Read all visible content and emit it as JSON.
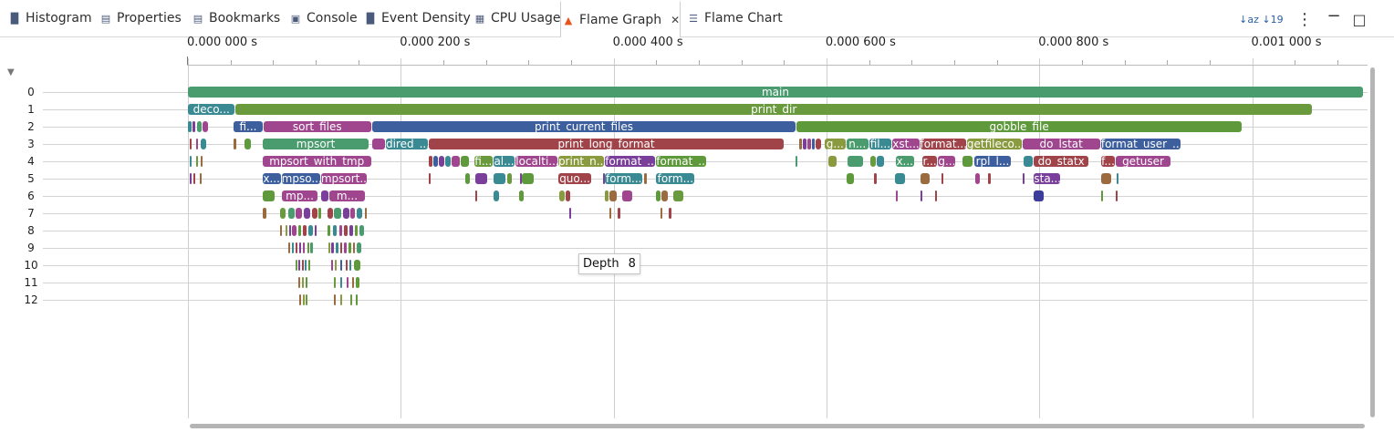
{
  "tabs": [
    {
      "label": "Histogram",
      "icon": "histogram-icon",
      "glyph": "▐▌"
    },
    {
      "label": "Properties",
      "icon": "properties-icon",
      "glyph": "▤"
    },
    {
      "label": "Bookmarks",
      "icon": "bookmarks-icon",
      "glyph": "▤"
    },
    {
      "label": "Console",
      "icon": "console-icon",
      "glyph": "▣"
    },
    {
      "label": "Event Density",
      "icon": "event-density-icon",
      "glyph": "▐▌"
    },
    {
      "label": "CPU Usage",
      "icon": "cpu-usage-icon",
      "glyph": "▦"
    },
    {
      "label": "Flame Graph",
      "icon": "flame-icon",
      "glyph": "▲"
    },
    {
      "label": "Flame Chart",
      "icon": "flame-chart-icon",
      "glyph": "☰"
    }
  ],
  "active_tab": "Flame Graph",
  "toolbar": {
    "sort_alpha": "↓az",
    "sort_num": "↓19",
    "menu": "⋮",
    "minimize": "−",
    "maximize": "□"
  },
  "axis_ticks": [
    "0.000 000 s",
    "0.000 200 s",
    "0.000 400 s",
    "0.000 600 s",
    "0.000 800 s",
    "0.001 000 s"
  ],
  "depth_labels": [
    "0",
    "1",
    "2",
    "3",
    "4",
    "5",
    "6",
    "7",
    "8",
    "9",
    "10",
    "11",
    "12"
  ],
  "tooltip": {
    "label": "Depth",
    "value": "8"
  },
  "colors": {
    "green": "#4a9b6e",
    "olive": "#6a9a3e",
    "blue": "#3d5f9e",
    "red": "#a0444a",
    "purple": "#7a3f9b",
    "magenta": "#a0468f",
    "teal": "#3a8a93",
    "yellowgreen": "#8a9a3e",
    "brown": "#9b6a3e",
    "lime": "#5e9a3c",
    "navy": "#3c3c9a"
  },
  "frames": [
    {
      "d": 0,
      "t0": 0,
      "t1": 1.105,
      "label": "main",
      "c": "green"
    },
    {
      "d": 1,
      "t0": 0,
      "t1": 0.045,
      "label": "deco...",
      "c": "teal"
    },
    {
      "d": 1,
      "t0": 0.045,
      "t1": 1.057,
      "label": "print_dir",
      "c": "olive"
    },
    {
      "d": 2,
      "t0": 0.043,
      "t1": 0.071,
      "label": "fi...",
      "c": "blue"
    },
    {
      "d": 2,
      "t0": 0.071,
      "t1": 0.173,
      "label": "sort_files",
      "c": "magenta"
    },
    {
      "d": 2,
      "t0": 0.173,
      "t1": 0.572,
      "label": "print_current_files",
      "c": "blue"
    },
    {
      "d": 2,
      "t0": 0.572,
      "t1": 0.991,
      "label": "gobble_file",
      "c": "lime"
    },
    {
      "d": 3,
      "t0": 0.07,
      "t1": 0.171,
      "label": "mpsort",
      "c": "green"
    },
    {
      "d": 3,
      "t0": 0.186,
      "t1": 0.226,
      "label": "dired_...",
      "c": "teal"
    },
    {
      "d": 3,
      "t0": 0.226,
      "t1": 0.561,
      "label": "print_long_format",
      "c": "red"
    },
    {
      "d": 3,
      "t0": 0.598,
      "t1": 0.619,
      "label": "g...",
      "c": "yellowgreen"
    },
    {
      "d": 3,
      "t0": 0.619,
      "t1": 0.64,
      "label": "n...",
      "c": "green"
    },
    {
      "d": 3,
      "t0": 0.64,
      "t1": 0.662,
      "label": "fil...",
      "c": "teal"
    },
    {
      "d": 3,
      "t0": 0.662,
      "t1": 0.688,
      "label": "xst...",
      "c": "magenta"
    },
    {
      "d": 3,
      "t0": 0.688,
      "t1": 0.732,
      "label": "format...",
      "c": "red"
    },
    {
      "d": 3,
      "t0": 0.732,
      "t1": 0.784,
      "label": "getfileco...",
      "c": "yellowgreen"
    },
    {
      "d": 3,
      "t0": 0.784,
      "t1": 0.858,
      "label": "do_lstat",
      "c": "magenta"
    },
    {
      "d": 3,
      "t0": 0.858,
      "t1": 0.934,
      "label": "format_user_...",
      "c": "blue"
    },
    {
      "d": 4,
      "t0": 0.07,
      "t1": 0.173,
      "label": "mpsort_with_tmp",
      "c": "magenta"
    },
    {
      "d": 4,
      "t0": 0.269,
      "t1": 0.287,
      "label": "fi...",
      "c": "olive"
    },
    {
      "d": 4,
      "t0": 0.287,
      "t1": 0.308,
      "label": "al...",
      "c": "teal"
    },
    {
      "d": 4,
      "t0": 0.308,
      "t1": 0.348,
      "label": "localti...",
      "c": "magenta"
    },
    {
      "d": 4,
      "t0": 0.348,
      "t1": 0.392,
      "label": "print_n...",
      "c": "yellowgreen"
    },
    {
      "d": 4,
      "t0": 0.392,
      "t1": 0.44,
      "label": "format_...",
      "c": "purple"
    },
    {
      "d": 4,
      "t0": 0.44,
      "t1": 0.488,
      "label": "format_...",
      "c": "lime"
    },
    {
      "d": 4,
      "t0": 0.665,
      "t1": 0.683,
      "label": "x...",
      "c": "green"
    },
    {
      "d": 4,
      "t0": 0.69,
      "t1": 0.705,
      "label": "r...",
      "c": "red"
    },
    {
      "d": 4,
      "t0": 0.705,
      "t1": 0.722,
      "label": "g...",
      "c": "magenta"
    },
    {
      "d": 4,
      "t0": 0.739,
      "t1": 0.774,
      "label": "rpl_l...",
      "c": "blue"
    },
    {
      "d": 4,
      "t0": 0.795,
      "t1": 0.847,
      "label": "do_statx",
      "c": "red"
    },
    {
      "d": 4,
      "t0": 0.858,
      "t1": 0.872,
      "label": "f...",
      "c": "red"
    },
    {
      "d": 4,
      "t0": 0.872,
      "t1": 0.924,
      "label": "getuser",
      "c": "magenta"
    },
    {
      "d": 5,
      "t0": 0.07,
      "t1": 0.088,
      "label": "x...",
      "c": "blue"
    },
    {
      "d": 5,
      "t0": 0.088,
      "t1": 0.125,
      "label": "mpso...",
      "c": "blue"
    },
    {
      "d": 5,
      "t0": 0.125,
      "t1": 0.169,
      "label": "mpsort...",
      "c": "magenta"
    },
    {
      "d": 5,
      "t0": 0.348,
      "t1": 0.38,
      "label": "quo...",
      "c": "red"
    },
    {
      "d": 5,
      "t0": 0.392,
      "t1": 0.428,
      "label": "form...",
      "c": "teal"
    },
    {
      "d": 5,
      "t0": 0.44,
      "t1": 0.477,
      "label": "form...",
      "c": "teal"
    },
    {
      "d": 5,
      "t0": 0.795,
      "t1": 0.82,
      "label": "sta...",
      "c": "purple"
    },
    {
      "d": 6,
      "t0": 0.088,
      "t1": 0.123,
      "label": "mp...",
      "c": "magenta"
    },
    {
      "d": 6,
      "t0": 0.133,
      "t1": 0.167,
      "label": "m...",
      "c": "magenta"
    }
  ],
  "smalls": [
    {
      "d": 2,
      "t0": 0.0,
      "t1": 0.004,
      "c": "teal"
    },
    {
      "d": 2,
      "t0": 0.004,
      "t1": 0.008,
      "c": "purple"
    },
    {
      "d": 2,
      "t0": 0.009,
      "t1": 0.014,
      "c": "green"
    },
    {
      "d": 2,
      "t0": 0.014,
      "t1": 0.02,
      "c": "magenta"
    },
    {
      "d": 2,
      "t0": 0.043,
      "t1": 0.05,
      "c": "red"
    },
    {
      "d": 3,
      "t0": 0.002,
      "t1": 0.004,
      "c": "red"
    },
    {
      "d": 3,
      "t0": 0.008,
      "t1": 0.01,
      "c": "magenta"
    },
    {
      "d": 3,
      "t0": 0.012,
      "t1": 0.018,
      "c": "teal"
    },
    {
      "d": 3,
      "t0": 0.043,
      "t1": 0.046,
      "c": "brown"
    },
    {
      "d": 3,
      "t0": 0.053,
      "t1": 0.06,
      "c": "lime"
    },
    {
      "d": 3,
      "t0": 0.071,
      "t1": 0.072,
      "c": "yellowgreen"
    },
    {
      "d": 3,
      "t0": 0.173,
      "t1": 0.186,
      "c": "magenta"
    },
    {
      "d": 3,
      "t0": 0.574,
      "t1": 0.578,
      "c": "brown"
    },
    {
      "d": 3,
      "t0": 0.578,
      "t1": 0.582,
      "c": "purple"
    },
    {
      "d": 3,
      "t0": 0.582,
      "t1": 0.586,
      "c": "magenta"
    },
    {
      "d": 3,
      "t0": 0.586,
      "t1": 0.59,
      "c": "blue"
    },
    {
      "d": 3,
      "t0": 0.59,
      "t1": 0.596,
      "c": "red"
    },
    {
      "d": 4,
      "t0": 0.002,
      "t1": 0.004,
      "c": "teal"
    },
    {
      "d": 4,
      "t0": 0.008,
      "t1": 0.01,
      "c": "olive"
    },
    {
      "d": 4,
      "t0": 0.012,
      "t1": 0.014,
      "c": "brown"
    },
    {
      "d": 4,
      "t0": 0.226,
      "t1": 0.231,
      "c": "red"
    },
    {
      "d": 4,
      "t0": 0.231,
      "t1": 0.236,
      "c": "blue"
    },
    {
      "d": 4,
      "t0": 0.236,
      "t1": 0.242,
      "c": "purple"
    },
    {
      "d": 4,
      "t0": 0.242,
      "t1": 0.248,
      "c": "teal"
    },
    {
      "d": 4,
      "t0": 0.248,
      "t1": 0.256,
      "c": "magenta"
    },
    {
      "d": 4,
      "t0": 0.256,
      "t1": 0.265,
      "c": "lime"
    },
    {
      "d": 4,
      "t0": 0.571,
      "t1": 0.573,
      "c": "green"
    },
    {
      "d": 4,
      "t0": 0.602,
      "t1": 0.61,
      "c": "yellowgreen"
    },
    {
      "d": 4,
      "t0": 0.62,
      "t1": 0.635,
      "c": "green"
    },
    {
      "d": 4,
      "t0": 0.641,
      "t1": 0.647,
      "c": "olive"
    },
    {
      "d": 4,
      "t0": 0.647,
      "t1": 0.655,
      "c": "teal"
    },
    {
      "d": 4,
      "t0": 0.728,
      "t1": 0.738,
      "c": "lime"
    },
    {
      "d": 4,
      "t0": 0.785,
      "t1": 0.795,
      "c": "teal"
    },
    {
      "d": 5,
      "t0": 0.002,
      "t1": 0.003,
      "c": "purple"
    },
    {
      "d": 5,
      "t0": 0.005,
      "t1": 0.007,
      "c": "red"
    },
    {
      "d": 5,
      "t0": 0.011,
      "t1": 0.012,
      "c": "brown"
    },
    {
      "d": 5,
      "t0": 0.226,
      "t1": 0.228,
      "c": "red"
    },
    {
      "d": 5,
      "t0": 0.261,
      "t1": 0.266,
      "c": "lime"
    },
    {
      "d": 5,
      "t0": 0.27,
      "t1": 0.282,
      "c": "purple"
    },
    {
      "d": 5,
      "t0": 0.287,
      "t1": 0.299,
      "c": "teal"
    },
    {
      "d": 5,
      "t0": 0.3,
      "t1": 0.305,
      "c": "olive"
    },
    {
      "d": 5,
      "t0": 0.312,
      "t1": 0.314,
      "c": "purple"
    },
    {
      "d": 5,
      "t0": 0.314,
      "t1": 0.326,
      "c": "lime"
    },
    {
      "d": 5,
      "t0": 0.39,
      "t1": 0.392,
      "c": "purple"
    },
    {
      "d": 5,
      "t0": 0.429,
      "t1": 0.432,
      "c": "brown"
    },
    {
      "d": 5,
      "t0": 0.619,
      "t1": 0.627,
      "c": "lime"
    },
    {
      "d": 5,
      "t0": 0.645,
      "t1": 0.648,
      "c": "red"
    },
    {
      "d": 5,
      "t0": 0.664,
      "t1": 0.675,
      "c": "teal"
    },
    {
      "d": 5,
      "t0": 0.688,
      "t1": 0.698,
      "c": "brown"
    },
    {
      "d": 5,
      "t0": 0.708,
      "t1": 0.711,
      "c": "red"
    },
    {
      "d": 5,
      "t0": 0.74,
      "t1": 0.745,
      "c": "magenta"
    },
    {
      "d": 5,
      "t0": 0.752,
      "t1": 0.755,
      "c": "red"
    },
    {
      "d": 5,
      "t0": 0.784,
      "t1": 0.787,
      "c": "purple"
    },
    {
      "d": 5,
      "t0": 0.858,
      "t1": 0.868,
      "c": "brown"
    },
    {
      "d": 5,
      "t0": 0.873,
      "t1": 0.875,
      "c": "teal"
    },
    {
      "d": 6,
      "t0": 0.07,
      "t1": 0.082,
      "c": "lime"
    },
    {
      "d": 6,
      "t0": 0.125,
      "t1": 0.133,
      "c": "purple"
    },
    {
      "d": 6,
      "t0": 0.27,
      "t1": 0.273,
      "c": "red"
    },
    {
      "d": 6,
      "t0": 0.287,
      "t1": 0.293,
      "c": "teal"
    },
    {
      "d": 6,
      "t0": 0.311,
      "t1": 0.316,
      "c": "lime"
    },
    {
      "d": 6,
      "t0": 0.349,
      "t1": 0.355,
      "c": "yellowgreen"
    },
    {
      "d": 6,
      "t0": 0.355,
      "t1": 0.36,
      "c": "red"
    },
    {
      "d": 6,
      "t0": 0.392,
      "t1": 0.396,
      "c": "yellowgreen"
    },
    {
      "d": 6,
      "t0": 0.396,
      "t1": 0.404,
      "c": "brown"
    },
    {
      "d": 6,
      "t0": 0.408,
      "t1": 0.418,
      "c": "magenta"
    },
    {
      "d": 6,
      "t0": 0.44,
      "t1": 0.445,
      "c": "lime"
    },
    {
      "d": 6,
      "t0": 0.445,
      "t1": 0.452,
      "c": "brown"
    },
    {
      "d": 6,
      "t0": 0.456,
      "t1": 0.466,
      "c": "olive"
    },
    {
      "d": 6,
      "t0": 0.665,
      "t1": 0.668,
      "c": "magenta"
    },
    {
      "d": 6,
      "t0": 0.688,
      "t1": 0.691,
      "c": "purple"
    },
    {
      "d": 6,
      "t0": 0.702,
      "t1": 0.704,
      "c": "red"
    },
    {
      "d": 6,
      "t0": 0.795,
      "t1": 0.805,
      "c": "navy"
    },
    {
      "d": 6,
      "t0": 0.858,
      "t1": 0.861,
      "c": "lime"
    },
    {
      "d": 6,
      "t0": 0.872,
      "t1": 0.874,
      "c": "red"
    },
    {
      "d": 7,
      "t0": 0.07,
      "t1": 0.075,
      "c": "brown"
    },
    {
      "d": 7,
      "t0": 0.087,
      "t1": 0.093,
      "c": "olive"
    },
    {
      "d": 7,
      "t0": 0.094,
      "t1": 0.101,
      "c": "green"
    },
    {
      "d": 7,
      "t0": 0.101,
      "t1": 0.108,
      "c": "magenta"
    },
    {
      "d": 7,
      "t0": 0.109,
      "t1": 0.116,
      "c": "purple"
    },
    {
      "d": 7,
      "t0": 0.117,
      "t1": 0.123,
      "c": "red"
    },
    {
      "d": 7,
      "t0": 0.123,
      "t1": 0.126,
      "c": "lime"
    },
    {
      "d": 7,
      "t0": 0.131,
      "t1": 0.137,
      "c": "red"
    },
    {
      "d": 7,
      "t0": 0.137,
      "t1": 0.145,
      "c": "green"
    },
    {
      "d": 7,
      "t0": 0.146,
      "t1": 0.153,
      "c": "purple"
    },
    {
      "d": 7,
      "t0": 0.153,
      "t1": 0.158,
      "c": "magenta"
    },
    {
      "d": 7,
      "t0": 0.159,
      "t1": 0.165,
      "c": "teal"
    },
    {
      "d": 7,
      "t0": 0.166,
      "t1": 0.169,
      "c": "brown"
    },
    {
      "d": 7,
      "t0": 0.358,
      "t1": 0.361,
      "c": "purple"
    },
    {
      "d": 7,
      "t0": 0.396,
      "t1": 0.398,
      "c": "brown"
    },
    {
      "d": 7,
      "t0": 0.404,
      "t1": 0.407,
      "c": "red"
    },
    {
      "d": 7,
      "t0": 0.444,
      "t1": 0.446,
      "c": "brown"
    },
    {
      "d": 7,
      "t0": 0.452,
      "t1": 0.455,
      "c": "red"
    },
    {
      "d": 8,
      "t0": 0.087,
      "t1": 0.089,
      "c": "brown"
    },
    {
      "d": 8,
      "t0": 0.092,
      "t1": 0.094,
      "c": "yellowgreen"
    },
    {
      "d": 8,
      "t0": 0.095,
      "t1": 0.097,
      "c": "purple"
    },
    {
      "d": 8,
      "t0": 0.098,
      "t1": 0.103,
      "c": "magenta"
    },
    {
      "d": 8,
      "t0": 0.104,
      "t1": 0.107,
      "c": "lime"
    },
    {
      "d": 8,
      "t0": 0.108,
      "t1": 0.112,
      "c": "red"
    },
    {
      "d": 8,
      "t0": 0.113,
      "t1": 0.118,
      "c": "teal"
    },
    {
      "d": 8,
      "t0": 0.119,
      "t1": 0.121,
      "c": "purple"
    },
    {
      "d": 8,
      "t0": 0.131,
      "t1": 0.135,
      "c": "lime"
    },
    {
      "d": 8,
      "t0": 0.136,
      "t1": 0.141,
      "c": "teal"
    },
    {
      "d": 8,
      "t0": 0.142,
      "t1": 0.146,
      "c": "magenta"
    },
    {
      "d": 8,
      "t0": 0.147,
      "t1": 0.151,
      "c": "red"
    },
    {
      "d": 8,
      "t0": 0.152,
      "t1": 0.156,
      "c": "purple"
    },
    {
      "d": 8,
      "t0": 0.157,
      "t1": 0.16,
      "c": "olive"
    },
    {
      "d": 8,
      "t0": 0.161,
      "t1": 0.166,
      "c": "green"
    },
    {
      "d": 9,
      "t0": 0.094,
      "t1": 0.096,
      "c": "brown"
    },
    {
      "d": 9,
      "t0": 0.098,
      "t1": 0.1,
      "c": "teal"
    },
    {
      "d": 9,
      "t0": 0.101,
      "t1": 0.104,
      "c": "red"
    },
    {
      "d": 9,
      "t0": 0.105,
      "t1": 0.107,
      "c": "purple"
    },
    {
      "d": 9,
      "t0": 0.108,
      "t1": 0.111,
      "c": "magenta"
    },
    {
      "d": 9,
      "t0": 0.112,
      "t1": 0.114,
      "c": "lime"
    },
    {
      "d": 9,
      "t0": 0.115,
      "t1": 0.118,
      "c": "green"
    },
    {
      "d": 9,
      "t0": 0.132,
      "t1": 0.134,
      "c": "yellowgreen"
    },
    {
      "d": 9,
      "t0": 0.135,
      "t1": 0.138,
      "c": "purple"
    },
    {
      "d": 9,
      "t0": 0.139,
      "t1": 0.142,
      "c": "teal"
    },
    {
      "d": 9,
      "t0": 0.143,
      "t1": 0.146,
      "c": "red"
    },
    {
      "d": 9,
      "t0": 0.147,
      "t1": 0.15,
      "c": "magenta"
    },
    {
      "d": 9,
      "t0": 0.151,
      "t1": 0.154,
      "c": "lime"
    },
    {
      "d": 9,
      "t0": 0.155,
      "t1": 0.158,
      "c": "brown"
    },
    {
      "d": 9,
      "t0": 0.159,
      "t1": 0.164,
      "c": "green"
    },
    {
      "d": 10,
      "t0": 0.101,
      "t1": 0.103,
      "c": "olive"
    },
    {
      "d": 10,
      "t0": 0.104,
      "t1": 0.106,
      "c": "purple"
    },
    {
      "d": 10,
      "t0": 0.107,
      "t1": 0.109,
      "c": "red"
    },
    {
      "d": 10,
      "t0": 0.11,
      "t1": 0.112,
      "c": "teal"
    },
    {
      "d": 10,
      "t0": 0.113,
      "t1": 0.116,
      "c": "lime"
    },
    {
      "d": 10,
      "t0": 0.135,
      "t1": 0.137,
      "c": "magenta"
    },
    {
      "d": 10,
      "t0": 0.138,
      "t1": 0.14,
      "c": "yellowgreen"
    },
    {
      "d": 10,
      "t0": 0.143,
      "t1": 0.146,
      "c": "blue"
    },
    {
      "d": 10,
      "t0": 0.148,
      "t1": 0.151,
      "c": "red"
    },
    {
      "d": 10,
      "t0": 0.152,
      "t1": 0.154,
      "c": "teal"
    },
    {
      "d": 10,
      "t0": 0.156,
      "t1": 0.163,
      "c": "lime"
    },
    {
      "d": 11,
      "t0": 0.104,
      "t1": 0.105,
      "c": "brown"
    },
    {
      "d": 11,
      "t0": 0.107,
      "t1": 0.109,
      "c": "yellowgreen"
    },
    {
      "d": 11,
      "t0": 0.111,
      "t1": 0.113,
      "c": "lime"
    },
    {
      "d": 11,
      "t0": 0.137,
      "t1": 0.139,
      "c": "olive"
    },
    {
      "d": 11,
      "t0": 0.143,
      "t1": 0.145,
      "c": "teal"
    },
    {
      "d": 11,
      "t0": 0.149,
      "t1": 0.151,
      "c": "magenta"
    },
    {
      "d": 11,
      "t0": 0.154,
      "t1": 0.156,
      "c": "brown"
    },
    {
      "d": 11,
      "t0": 0.158,
      "t1": 0.162,
      "c": "lime"
    },
    {
      "d": 12,
      "t0": 0.105,
      "t1": 0.106,
      "c": "brown"
    },
    {
      "d": 12,
      "t0": 0.108,
      "t1": 0.109,
      "c": "yellowgreen"
    },
    {
      "d": 12,
      "t0": 0.111,
      "t1": 0.112,
      "c": "olive"
    },
    {
      "d": 12,
      "t0": 0.137,
      "t1": 0.138,
      "c": "brown"
    },
    {
      "d": 12,
      "t0": 0.143,
      "t1": 0.144,
      "c": "yellowgreen"
    },
    {
      "d": 12,
      "t0": 0.153,
      "t1": 0.154,
      "c": "olive"
    },
    {
      "d": 12,
      "t0": 0.158,
      "t1": 0.16,
      "c": "lime"
    }
  ]
}
